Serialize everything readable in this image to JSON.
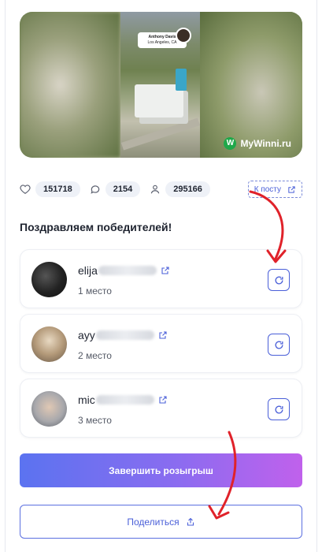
{
  "hero": {
    "tag_name": "Anthony Davis",
    "tag_location": "Los Angeles, CA",
    "brand_text": "MyWinni.ru",
    "brand_logo": "W"
  },
  "stats": {
    "likes": "151718",
    "comments": "2154",
    "participants": "295166",
    "post_link": "К посту"
  },
  "congrats_title": "Поздравляем победителей!",
  "winners": [
    {
      "name_visible": "elija",
      "place": "1 место",
      "avatar_color": "#2b2b2b"
    },
    {
      "name_visible": "ayy",
      "place": "2 место",
      "avatar_color": "#b8a58c"
    },
    {
      "name_visible": "mic",
      "place": "3 место",
      "avatar_color": "#9aa0a8"
    }
  ],
  "buttons": {
    "finish": "Завершить розыгрыш",
    "share": "Поделиться"
  },
  "colors": {
    "accent": "#4a5fd8",
    "annotation": "#e0222a",
    "brand_green": "#1fa84a"
  }
}
